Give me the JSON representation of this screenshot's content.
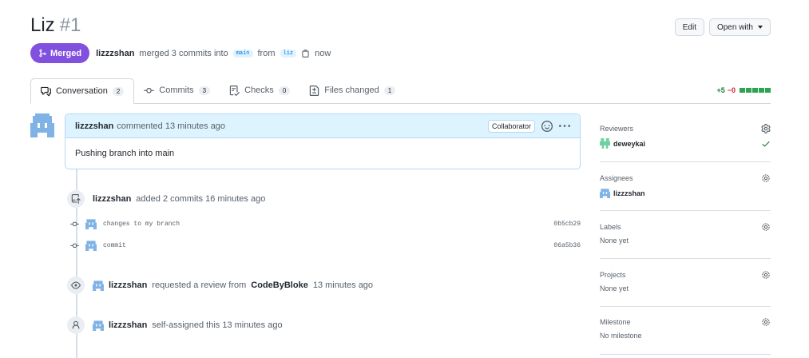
{
  "header": {
    "title": "Liz",
    "number": "#1",
    "edit_label": "Edit",
    "open_with_label": "Open with"
  },
  "meta": {
    "status": "Merged",
    "author": "lizzzshan",
    "action": "merged 3 commits into",
    "base_branch": "main",
    "from_word": "from",
    "head_branch": "liz",
    "time": "now"
  },
  "tabs": [
    {
      "label": "Conversation",
      "count": "2"
    },
    {
      "label": "Commits",
      "count": "3"
    },
    {
      "label": "Checks",
      "count": "0"
    },
    {
      "label": "Files changed",
      "count": "1"
    }
  ],
  "diffstat": {
    "additions": "+5",
    "deletions": "−0"
  },
  "comment": {
    "author": "lizzzshan",
    "action": "commented 13 minutes ago",
    "role": "Collaborator",
    "body": "Pushing branch into main"
  },
  "commits_event": {
    "author": "lizzzshan",
    "text": "added 2 commits 16 minutes ago"
  },
  "commits": [
    {
      "message": "changes to my branch",
      "sha": "0b5cb29"
    },
    {
      "message": "commit",
      "sha": "06a5b36"
    }
  ],
  "review_event": {
    "author": "lizzzshan",
    "text": "requested a review from",
    "reviewer": "CodeByBloke",
    "time": "13 minutes ago"
  },
  "assign_event": {
    "author": "lizzzshan",
    "text": "self-assigned this 13 minutes ago"
  },
  "sidebar": {
    "reviewers": {
      "title": "Reviewers",
      "value": "deweykai"
    },
    "assignees": {
      "title": "Assignees",
      "value": "lizzzshan"
    },
    "labels": {
      "title": "Labels",
      "value": "None yet"
    },
    "projects": {
      "title": "Projects",
      "value": "None yet"
    },
    "milestone": {
      "title": "Milestone",
      "value": "No milestone"
    }
  },
  "colors": {
    "merged": "#8250df",
    "link": "#0969da",
    "success": "#1a7f37"
  }
}
